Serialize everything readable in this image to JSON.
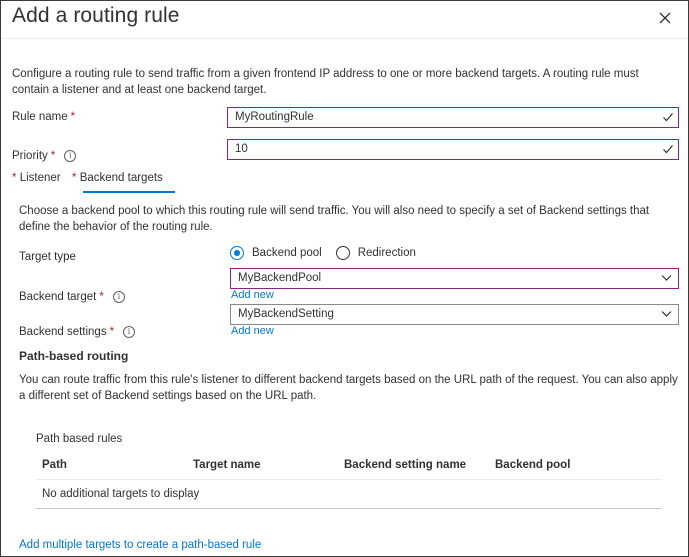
{
  "dialog": {
    "title": "Add a routing rule",
    "description": "Configure a routing rule to send traffic from a given frontend IP address to one or more backend targets. A routing rule must contain a listener and at least one backend target."
  },
  "form": {
    "rule_name_label": "Rule name",
    "rule_name_value": "MyRoutingRule",
    "priority_label": "Priority",
    "priority_value": "10",
    "required_mark": "*"
  },
  "tabs": [
    {
      "label": "Listener",
      "active": false
    },
    {
      "label": "Backend targets",
      "active": true
    }
  ],
  "backend": {
    "description": "Choose a backend pool to which this routing rule will send traffic. You will also need to specify a set of Backend settings that define the behavior of the routing rule.",
    "target_type_label": "Target type",
    "radio_pool_label": "Backend pool",
    "radio_redirect_label": "Redirection",
    "backend_target_label": "Backend target",
    "backend_target_value": "MyBackendPool",
    "add_new_1": "Add new",
    "backend_settings_label": "Backend settings",
    "backend_settings_value": "MyBackendSetting",
    "add_new_2": "Add new"
  },
  "path_routing": {
    "heading": "Path-based routing",
    "description": "You can route traffic from this rule's listener to different backend targets based on the URL path of the request. You can also apply a different set of Backend settings based on the URL path.",
    "rules_label": "Path based rules",
    "columns": [
      "Path",
      "Target name",
      "Backend setting name",
      "Backend pool"
    ],
    "empty_text": "No additional targets to display",
    "add_multiple_link": "Add multiple targets to create a path-based rule"
  },
  "icons": {
    "close": "close-icon",
    "check": "checkmark-icon",
    "chevron": "chevron-down-icon",
    "info": "info-icon"
  },
  "colors": {
    "accent": "#0078d4",
    "valid_border": "#8a2483",
    "required": "#a4262c"
  }
}
